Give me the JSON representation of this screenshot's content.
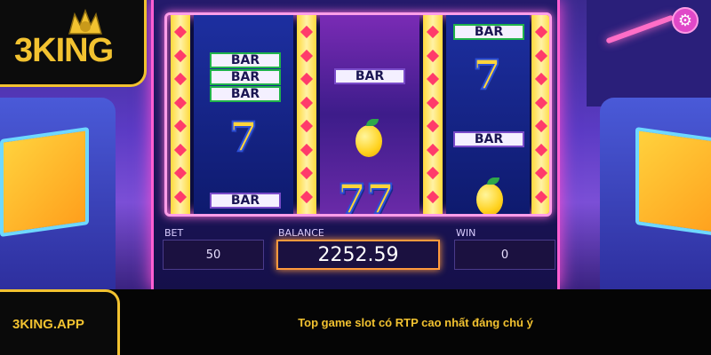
{
  "brand": {
    "logo_text": "3KING",
    "site": "3KING.APP"
  },
  "caption": "Top game slot có RTP cao nhất đáng chú ý",
  "reels": {
    "left": [
      "BAR",
      "BAR",
      "BAR",
      "7",
      "BAR"
    ],
    "middle": [
      "BAR",
      "lemon",
      "77"
    ],
    "right": [
      "BAR",
      "7",
      "BAR",
      "lemon"
    ]
  },
  "meters": {
    "bet_label": "BET",
    "bet_value": "50",
    "balance_label": "BALANCE",
    "balance_value": "2252.59",
    "win_label": "WIN",
    "win_value": "0"
  },
  "icons": {
    "settings": "gear-icon",
    "lemon": "lemon-icon",
    "crest": "king-crest-icon"
  },
  "colors": {
    "gold": "#f2c230",
    "neon_pink": "#ff5fd2",
    "balance_border": "#ff9a3d"
  }
}
